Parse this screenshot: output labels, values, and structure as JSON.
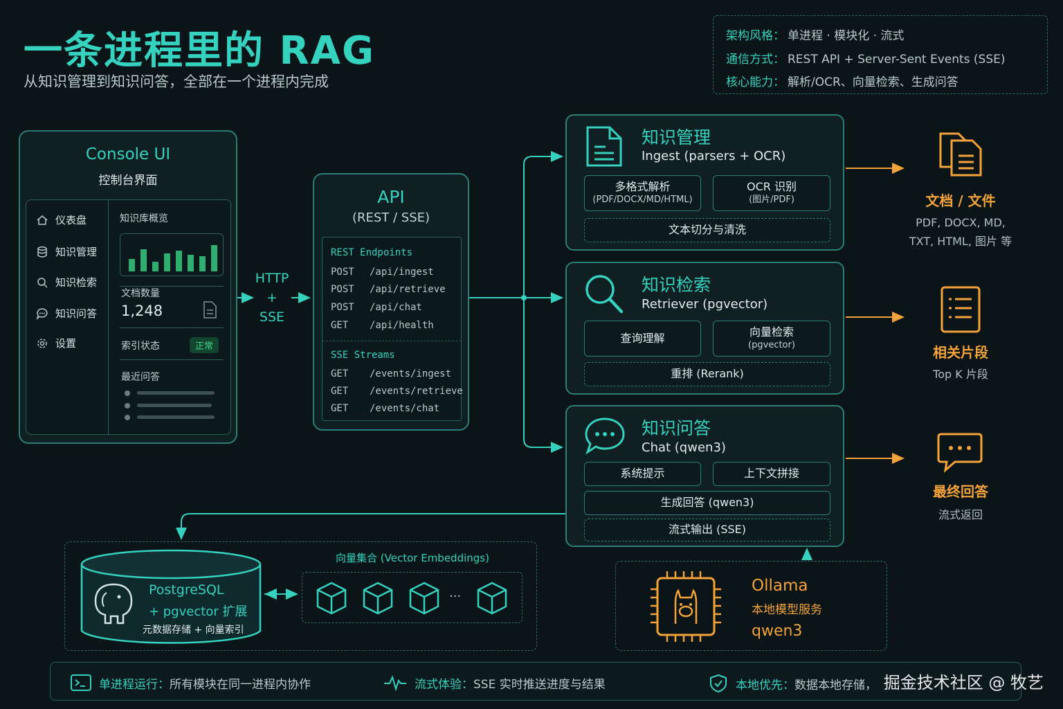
{
  "title": "一条进程里的 RAG",
  "subtitle": "从知识管理到知识问答，全部在一个进程内完成",
  "info": [
    {
      "key": "架构风格：",
      "value": "单进程 · 模块化 · 流式"
    },
    {
      "key": "通信方式：",
      "value": "REST API + Server-Sent Events (SSE)"
    },
    {
      "key": "核心能力：",
      "value": "解析/OCR、向量检索、生成问答"
    }
  ],
  "console": {
    "title": "Console UI",
    "subtitle": "控制台界面",
    "nav": [
      {
        "label": "仪表盘",
        "icon": "home-icon"
      },
      {
        "label": "知识管理",
        "icon": "database-icon"
      },
      {
        "label": "知识检索",
        "icon": "search-icon"
      },
      {
        "label": "知识问答",
        "icon": "chat-icon"
      },
      {
        "label": "设置",
        "icon": "gear-icon"
      }
    ],
    "overview_label": "知识库概览",
    "bar_levels": [
      0.45,
      0.8,
      0.35,
      0.65,
      0.75,
      0.6,
      0.55,
      0.95
    ],
    "doc_count_label": "文档数量",
    "doc_count": "1,248",
    "index_status_label": "索引状态",
    "index_status": "正常",
    "recent_label": "最近问答"
  },
  "transport": {
    "http": "HTTP",
    "plus": "+",
    "sse": "SSE"
  },
  "api": {
    "title": "API",
    "subtitle": "(REST / SSE)",
    "rest_header": "REST Endpoints",
    "rest": [
      {
        "method": "POST",
        "path": "/api/ingest"
      },
      {
        "method": "POST",
        "path": "/api/retrieve"
      },
      {
        "method": "POST",
        "path": "/api/chat"
      },
      {
        "method": "GET",
        "path": "/api/health"
      }
    ],
    "sse_header": "SSE Streams",
    "sse": [
      {
        "method": "GET",
        "path": "/events/ingest"
      },
      {
        "method": "GET",
        "path": "/events/retrieve"
      },
      {
        "method": "GET",
        "path": "/events/chat"
      }
    ]
  },
  "modules": {
    "ingest": {
      "title": "知识管理",
      "subtitle": "Ingest (parsers + OCR)",
      "chip1": {
        "line1": "多格式解析",
        "line2": "(PDF/DOCX/MD/HTML)"
      },
      "chip2": {
        "line1": "OCR 识别",
        "line2": "(图片/PDF)"
      },
      "chip3": "文本切分与清洗"
    },
    "retriever": {
      "title": "知识检索",
      "subtitle": "Retriever (pgvector)",
      "chip1": "查询理解",
      "chip2": {
        "line1": "向量检索",
        "line2": "(pgvector)"
      },
      "chip3": "重排 (Rerank)"
    },
    "chat": {
      "title": "知识问答",
      "subtitle": "Chat (qwen3)",
      "chip1": "系统提示",
      "chip2": "上下文拼接",
      "chip3": "生成回答 (qwen3)",
      "chip4": "流式输出 (SSE)"
    }
  },
  "outputs": [
    {
      "title": "文档 / 文件",
      "line1": "PDF, DOCX, MD,",
      "line2": "TXT, HTML, 图片 等"
    },
    {
      "title": "相关片段",
      "line1": "Top K 片段",
      "line2": ""
    },
    {
      "title": "最终回答",
      "line1": "流式返回",
      "line2": ""
    }
  ],
  "storage": {
    "db_line1": "PostgreSQL",
    "db_line2": "+ pgvector 扩展",
    "db_line3": "元数据存储 + 向量索引",
    "vectors_label": "向量集合 (Vector Embeddings)",
    "ellipsis": "···"
  },
  "ollama": {
    "title": "Ollama",
    "subtitle": "本地模型服务",
    "model": "qwen3"
  },
  "footer": [
    {
      "key": "单进程运行：",
      "value": "所有模块在同一进程内协作",
      "icon": "terminal-icon"
    },
    {
      "key": "流式体验：",
      "value": "SSE 实时推送进度与结果",
      "icon": "pulse-icon"
    },
    {
      "key": "本地优先：",
      "value": "数据本地存储，",
      "icon": "shield-icon"
    }
  ],
  "watermark": "掘金技术社区 @ 牧艺",
  "colors": {
    "accent": "#35d2c0",
    "border": "#2b7f77",
    "orange": "#f3a33a",
    "background": "#0b1518"
  }
}
